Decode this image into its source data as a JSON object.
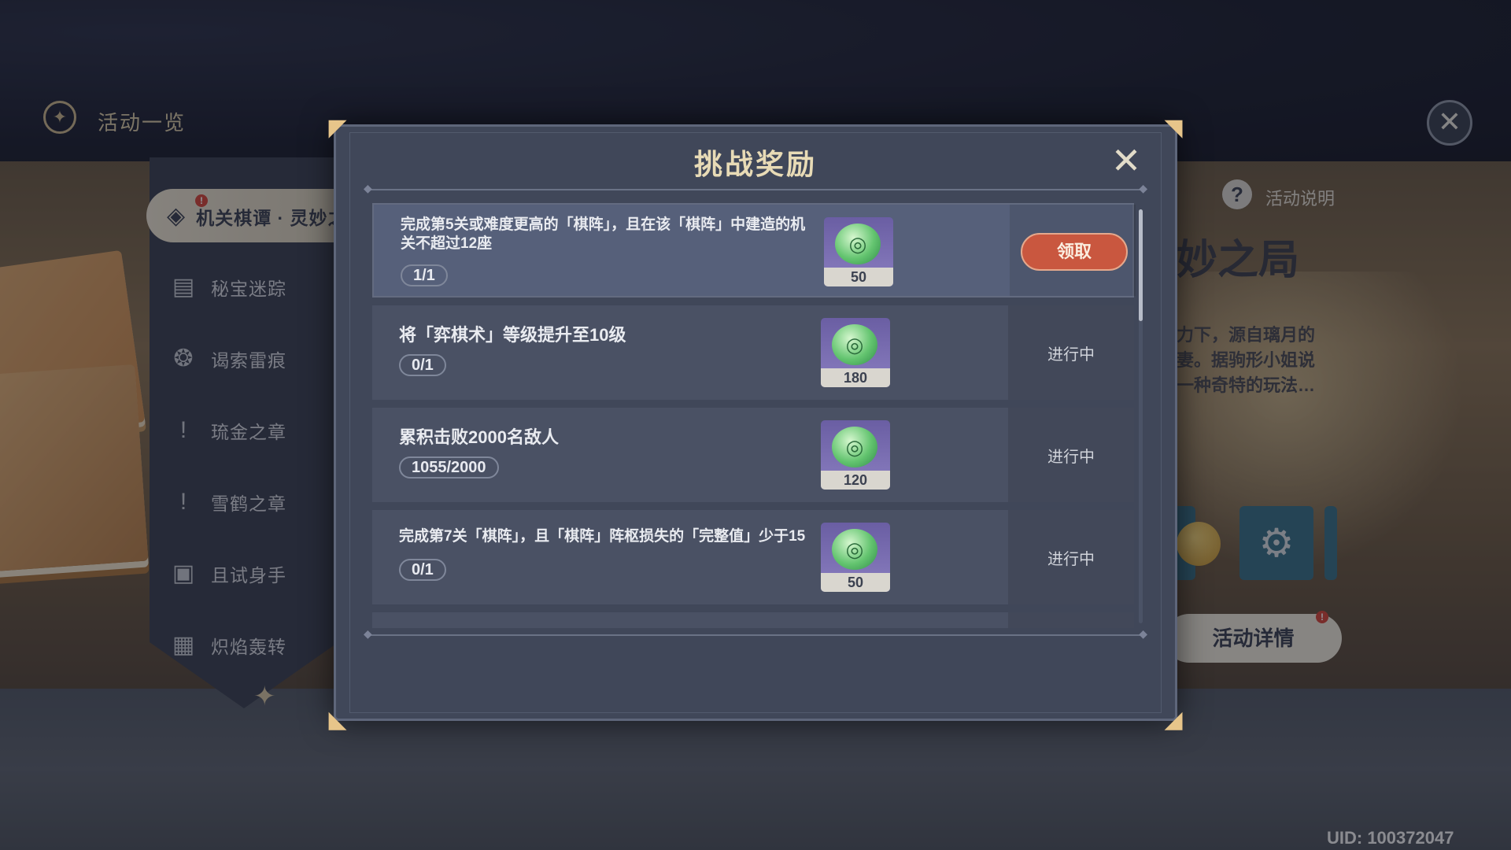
{
  "header": {
    "title": "活动一览"
  },
  "sidebar": {
    "items": [
      {
        "label": "机关棋谭 · 灵妙之局",
        "icon": "chess-piece-icon",
        "active": true,
        "badge": "!"
      },
      {
        "label": "秘宝迷踪",
        "icon": "treasure-chest-icon"
      },
      {
        "label": "谒索雷痕",
        "icon": "electro-swirl-icon"
      },
      {
        "label": "琉金之章",
        "icon": "exclamation-drop-icon"
      },
      {
        "label": "雪鹤之章",
        "icon": "exclamation-drop-icon"
      },
      {
        "label": "且试身手",
        "icon": "cards-icon"
      },
      {
        "label": "炽焰轰转",
        "icon": "puzzle-icon"
      }
    ]
  },
  "right_panel": {
    "help_label": "活动说明",
    "title": "妙之局",
    "description": [
      "力下，源自璃月的",
      "妻。据驹形小姐说",
      "一种奇特的玩法…"
    ],
    "details_button": "活动详情",
    "details_badge": "!"
  },
  "modal": {
    "title": "挑战奖励",
    "tasks": [
      {
        "description": "完成第5关或难度更高的「棋阵」，且在该「棋阵」中建造的机关不超过12座",
        "progress": "1/1",
        "reward_count": "50",
        "status": "领取",
        "claimable": true
      },
      {
        "description": "将「弈棋术」等级提升至10级",
        "progress": "0/1",
        "reward_count": "180",
        "status": "进行中",
        "claimable": false
      },
      {
        "description": "累积击败2000名敌人",
        "progress": "1055/2000",
        "reward_count": "120",
        "status": "进行中",
        "claimable": false
      },
      {
        "description": "完成第7关「棋阵」，且「棋阵」阵枢损失的「完整值」少于15",
        "progress": "0/1",
        "reward_count": "50",
        "status": "进行中",
        "claimable": false
      }
    ]
  },
  "footer": {
    "uid": "UID: 100372047"
  },
  "colors": {
    "modal_bg": "#404759",
    "claim_button": "#c9573f",
    "title_gold": "#e8dbb6",
    "reward_item_bg": "#7a6eb3"
  }
}
